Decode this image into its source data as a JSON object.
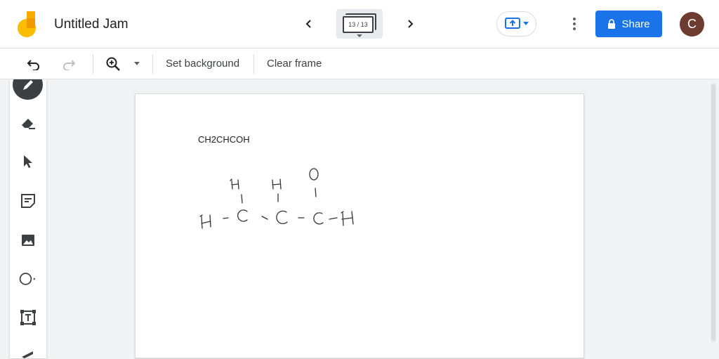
{
  "app": {
    "title": "Untitled Jam",
    "frame_counter": "13 / 13",
    "share_label": "Share",
    "avatar_initial": "C",
    "accent": "#1a73e8"
  },
  "toolbar": {
    "set_background": "Set background",
    "clear_frame": "Clear frame"
  },
  "sidebar": {
    "tools": [
      "pen-icon",
      "eraser-icon",
      "select-icon",
      "sticky-note-icon",
      "image-icon",
      "shape-icon",
      "text-box-icon",
      "laser-icon"
    ]
  },
  "frame": {
    "typed_text": "CH2CHCOH",
    "drawing": {
      "description_atoms": [
        "H",
        "C",
        "C",
        "C",
        "H",
        "H",
        "H",
        "O"
      ]
    }
  }
}
